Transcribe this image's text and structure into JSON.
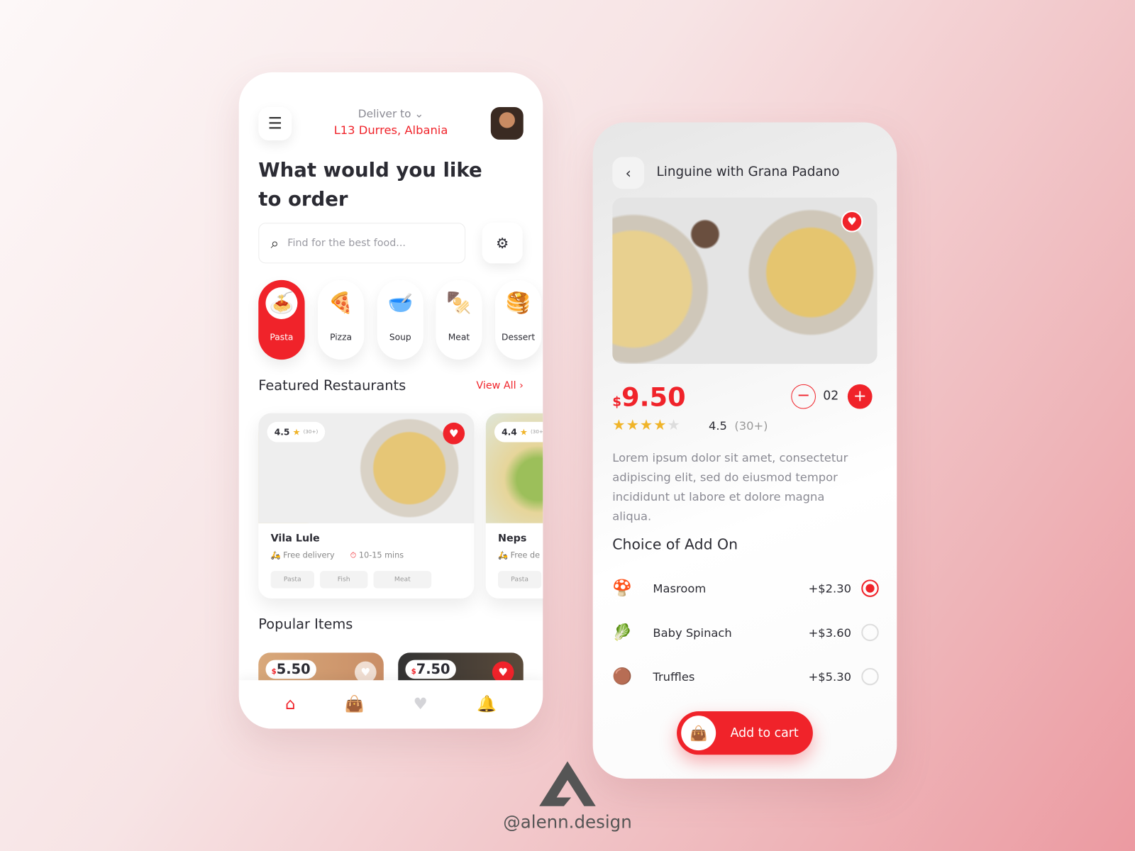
{
  "home": {
    "deliver_label": "Deliver to",
    "location": "L13 Durres, Albania",
    "headline_1": "What would you like",
    "headline_2": "to order",
    "search_placeholder": "Find for the best food...",
    "categories": [
      {
        "label": "Pasta",
        "icon": "🍝"
      },
      {
        "label": "Pizza",
        "icon": "🍕"
      },
      {
        "label": "Soup",
        "icon": "🥣"
      },
      {
        "label": "Meat",
        "icon": "🍢"
      },
      {
        "label": "Dessert",
        "icon": "🥞"
      }
    ],
    "featured_title": "Featured Restaurants",
    "view_all": "View All",
    "restaurants": [
      {
        "name": "Vila Lule",
        "rating": "4.5",
        "reviews": "(30+)",
        "delivery": "Free delivery",
        "time": "10-15 mins",
        "tags": [
          "Pasta",
          "Fish",
          "Meat"
        ]
      },
      {
        "name": "Neps",
        "rating": "4.4",
        "reviews": "(30+)",
        "delivery": "Free de",
        "tags": [
          "Pasta"
        ]
      }
    ],
    "popular_title": "Popular Items",
    "popular": [
      {
        "currency": "$",
        "price": "5.50"
      },
      {
        "currency": "$",
        "price": "7.50"
      }
    ]
  },
  "detail": {
    "title": "Linguine with Grana Padano",
    "currency": "$",
    "price": "9.50",
    "quantity": "02",
    "rating": "4.5",
    "stars": 4.5,
    "reviews": "(30+)",
    "description": "Lorem ipsum dolor sit amet, consectetur adipiscing elit, sed do eiusmod tempor incididunt ut labore et dolore magna aliqua.",
    "addon_title": "Choice of Add On",
    "addons": [
      {
        "name": "Masroom",
        "price": "+$2.30",
        "selected": true
      },
      {
        "name": "Baby Spinach",
        "price": "+$3.60",
        "selected": false
      },
      {
        "name": "Truffles",
        "price": "+$5.30",
        "selected": false
      }
    ],
    "cart_label": "Add to cart"
  },
  "watermark": "@alenn.design",
  "colors": {
    "accent": "#f0232a",
    "star": "#f0b429"
  }
}
